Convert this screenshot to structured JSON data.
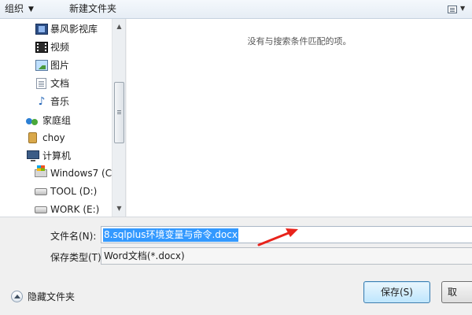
{
  "toolbar": {
    "organize_label": "组织",
    "new_folder_label": "新建文件夹"
  },
  "nav": {
    "items": [
      {
        "label": "暴风影视库",
        "icon": "media-library-icon"
      },
      {
        "label": "视频",
        "icon": "video-icon"
      },
      {
        "label": "图片",
        "icon": "picture-icon"
      },
      {
        "label": "文档",
        "icon": "document-icon"
      },
      {
        "label": "音乐",
        "icon": "music-icon"
      },
      {
        "label": "家庭组",
        "icon": "homegroup-icon"
      },
      {
        "label": "choy",
        "icon": "user-folder-icon"
      },
      {
        "label": "计算机",
        "icon": "computer-icon"
      },
      {
        "label": "Windows7 (C:",
        "icon": "windows-drive-icon"
      },
      {
        "label": "TOOL (D:)",
        "icon": "drive-icon"
      },
      {
        "label": "WORK (E:)",
        "icon": "drive-icon"
      }
    ]
  },
  "content": {
    "empty_message": "没有与搜索条件匹配的项。"
  },
  "form": {
    "filename_label": "文件名(N):",
    "filename_value": "8.sqlplus环境变量与命令.docx",
    "filetype_label": "保存类型(T):",
    "filetype_value": "Word文档(*.docx)"
  },
  "footer": {
    "hide_folders_label": "隐藏文件夹",
    "save_label": "保存(S)",
    "cancel_label": "取"
  },
  "colors": {
    "selection": "#3399ff",
    "annotation_arrow": "#e8231b"
  }
}
